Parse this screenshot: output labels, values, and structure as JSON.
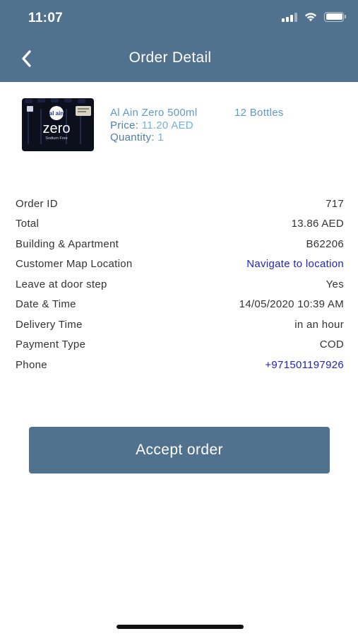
{
  "status_bar": {
    "time": "11:07",
    "icons": [
      "signal-icon",
      "wifi-icon",
      "battery-icon"
    ]
  },
  "nav": {
    "title": "Order Detail",
    "back_icon": "chevron-left-icon"
  },
  "product": {
    "image": "water-bottle-pack-image",
    "brand_text": "al ain",
    "logo_text": "zero",
    "logo_subtext": "Sodium Free",
    "name": "Al Ain Zero 500ml",
    "count": "12 Bottles",
    "price_label": "Price: ",
    "price_value": "11.20 AED",
    "quantity_label": "Quantity: ",
    "quantity_value": "1"
  },
  "details": [
    {
      "label": "Order ID",
      "value": "717",
      "link": false
    },
    {
      "label": "Total",
      "value": "13.86 AED",
      "link": false
    },
    {
      "label": "Building & Apartment",
      "value": "B62206",
      "link": false
    },
    {
      "label": "Customer Map Location",
      "value": "Navigate to location",
      "link": true
    },
    {
      "label": "Leave at door step",
      "value": "Yes",
      "link": false
    },
    {
      "label": "Date & Time",
      "value": "14/05/2020 10:39 AM",
      "link": false
    },
    {
      "label": "Delivery Time",
      "value": "in an hour",
      "link": false
    },
    {
      "label": "Payment Type",
      "value": "COD",
      "link": false
    },
    {
      "label": "Phone",
      "value": "+971501197926",
      "link": true
    }
  ],
  "actions": {
    "accept_label": "Accept order"
  },
  "colors": {
    "header": "#51728f",
    "link": "#1f22c9",
    "accent": "#5f9ac7",
    "text": "#333333"
  }
}
